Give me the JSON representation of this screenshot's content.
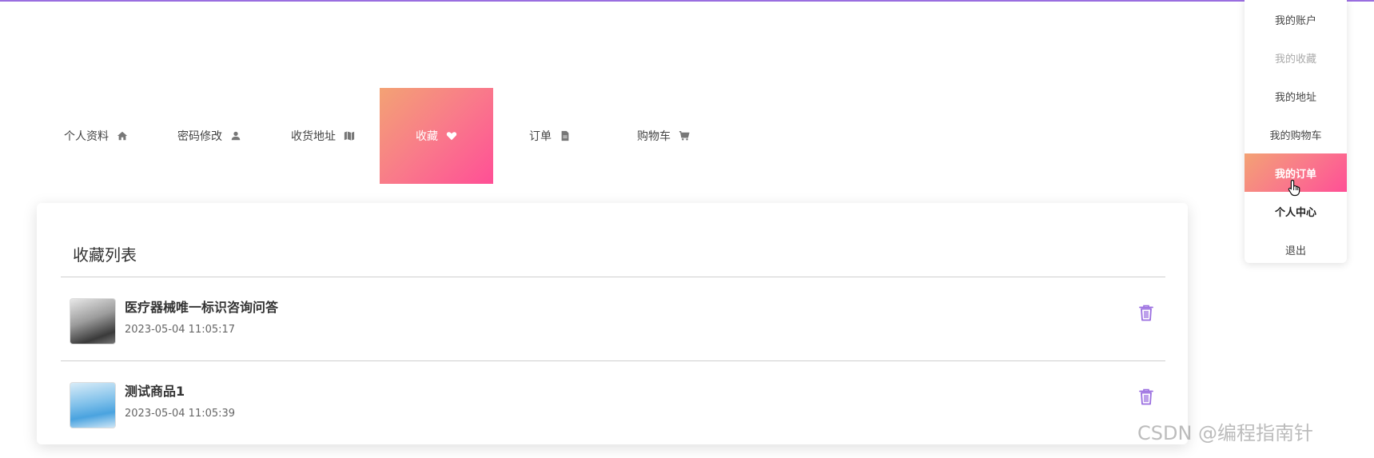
{
  "tabs": [
    {
      "label": "个人资料",
      "icon": "home-icon"
    },
    {
      "label": "密码修改",
      "icon": "user-icon"
    },
    {
      "label": "收货地址",
      "icon": "map-icon"
    },
    {
      "label": "收藏",
      "icon": "heart-icon",
      "active": true
    },
    {
      "label": "订单",
      "icon": "file-icon"
    },
    {
      "label": "购物车",
      "icon": "cart-icon"
    }
  ],
  "favorites": {
    "title": "收藏列表",
    "items": [
      {
        "name": "医疗器械唯一标识咨询问答",
        "time": "2023-05-04 11:05:17"
      },
      {
        "name": "测试商品1",
        "time": "2023-05-04 11:05:39"
      }
    ]
  },
  "dropdown": {
    "items": [
      {
        "label": "我的账户"
      },
      {
        "label": "我的收藏"
      },
      {
        "label": "我的地址"
      },
      {
        "label": "我的购物车"
      },
      {
        "label": "我的订单"
      },
      {
        "label": "个人中心"
      },
      {
        "label": "退出"
      }
    ]
  },
  "watermark": "CSDN @编程指南针",
  "colors": {
    "accent_start": "#f3a274",
    "accent_end": "#ff4f96",
    "trash": "#9a6ee0",
    "top_line": "#9a6ee0"
  }
}
